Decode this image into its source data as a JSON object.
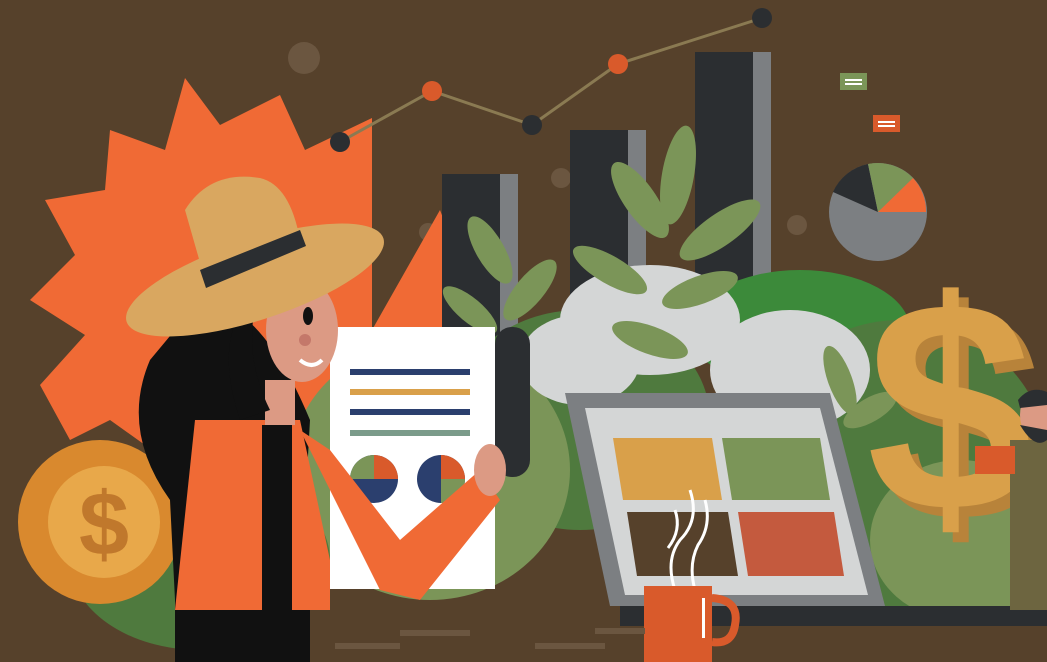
{
  "scene": {
    "description_tags": [
      "business-growth-illustration"
    ],
    "colors": {
      "background": "#56412b",
      "orange": "#f06a35",
      "orange_dark": "#d95a2b",
      "gold": "#d9a04a",
      "gold_dark": "#b8833a",
      "charcoal": "#2b2e31",
      "gray": "#7c7f82",
      "light_gray": "#d4d6d6",
      "green": "#7b9558",
      "green_dark": "#4f7a3e",
      "green_bright": "#3c8a3a",
      "skin": "#dc9a84",
      "navy": "#2b3f6e",
      "hat": "#d9a760",
      "hat_band": "#2b2e31",
      "white": "#ffffff"
    },
    "symbols": {
      "coin_symbol": "$",
      "dollar_sign": "$"
    }
  }
}
